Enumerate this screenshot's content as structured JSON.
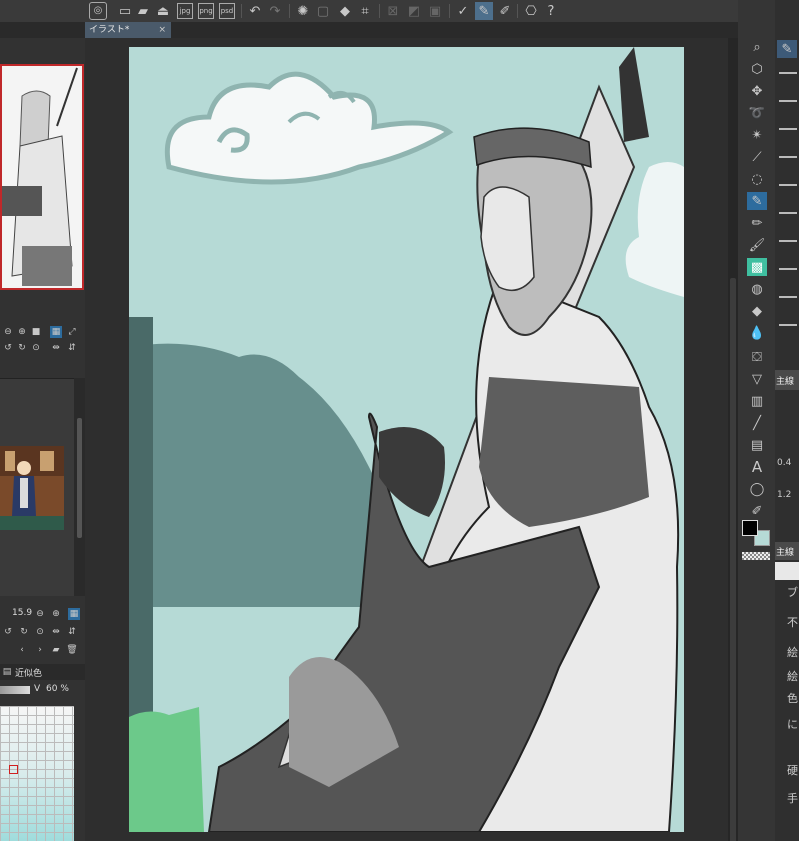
{
  "document": {
    "tab_title": "イラスト*",
    "close_glyph": "×"
  },
  "navigator": {
    "zoom": "15.9"
  },
  "color": {
    "tab_label": "近似色",
    "v_label": "V",
    "v_value": "60 %"
  },
  "tool_property": {
    "brush_size": "0.4",
    "opacity": "1.2",
    "header_main": "主線",
    "header_main2": "主線",
    "labels": [
      "ブ",
      "不",
      "絵",
      "絵",
      "色",
      "に",
      "硬",
      "手"
    ]
  },
  "icons": {
    "toolbar": [
      "logo-icon",
      "new-file-icon",
      "open-icon",
      "save-icon",
      "export-icon",
      "export-icon",
      "export-icon",
      "undo-icon",
      "redo-icon",
      "busy-icon",
      "clear-icon",
      "fill-icon",
      "transform-icon",
      "ruler-icon",
      "ruler-icon",
      "ruler-icon",
      "check-icon",
      "pen-stroke-icon",
      "pen-edit-icon",
      "cube-icon",
      "help-icon"
    ]
  },
  "colors": {
    "sky": "#b6dad6",
    "ui_bg": "#323232",
    "accent": "#2d6c9e",
    "fg_swatch": "#000000",
    "bg_swatch": "#b6dad6"
  }
}
